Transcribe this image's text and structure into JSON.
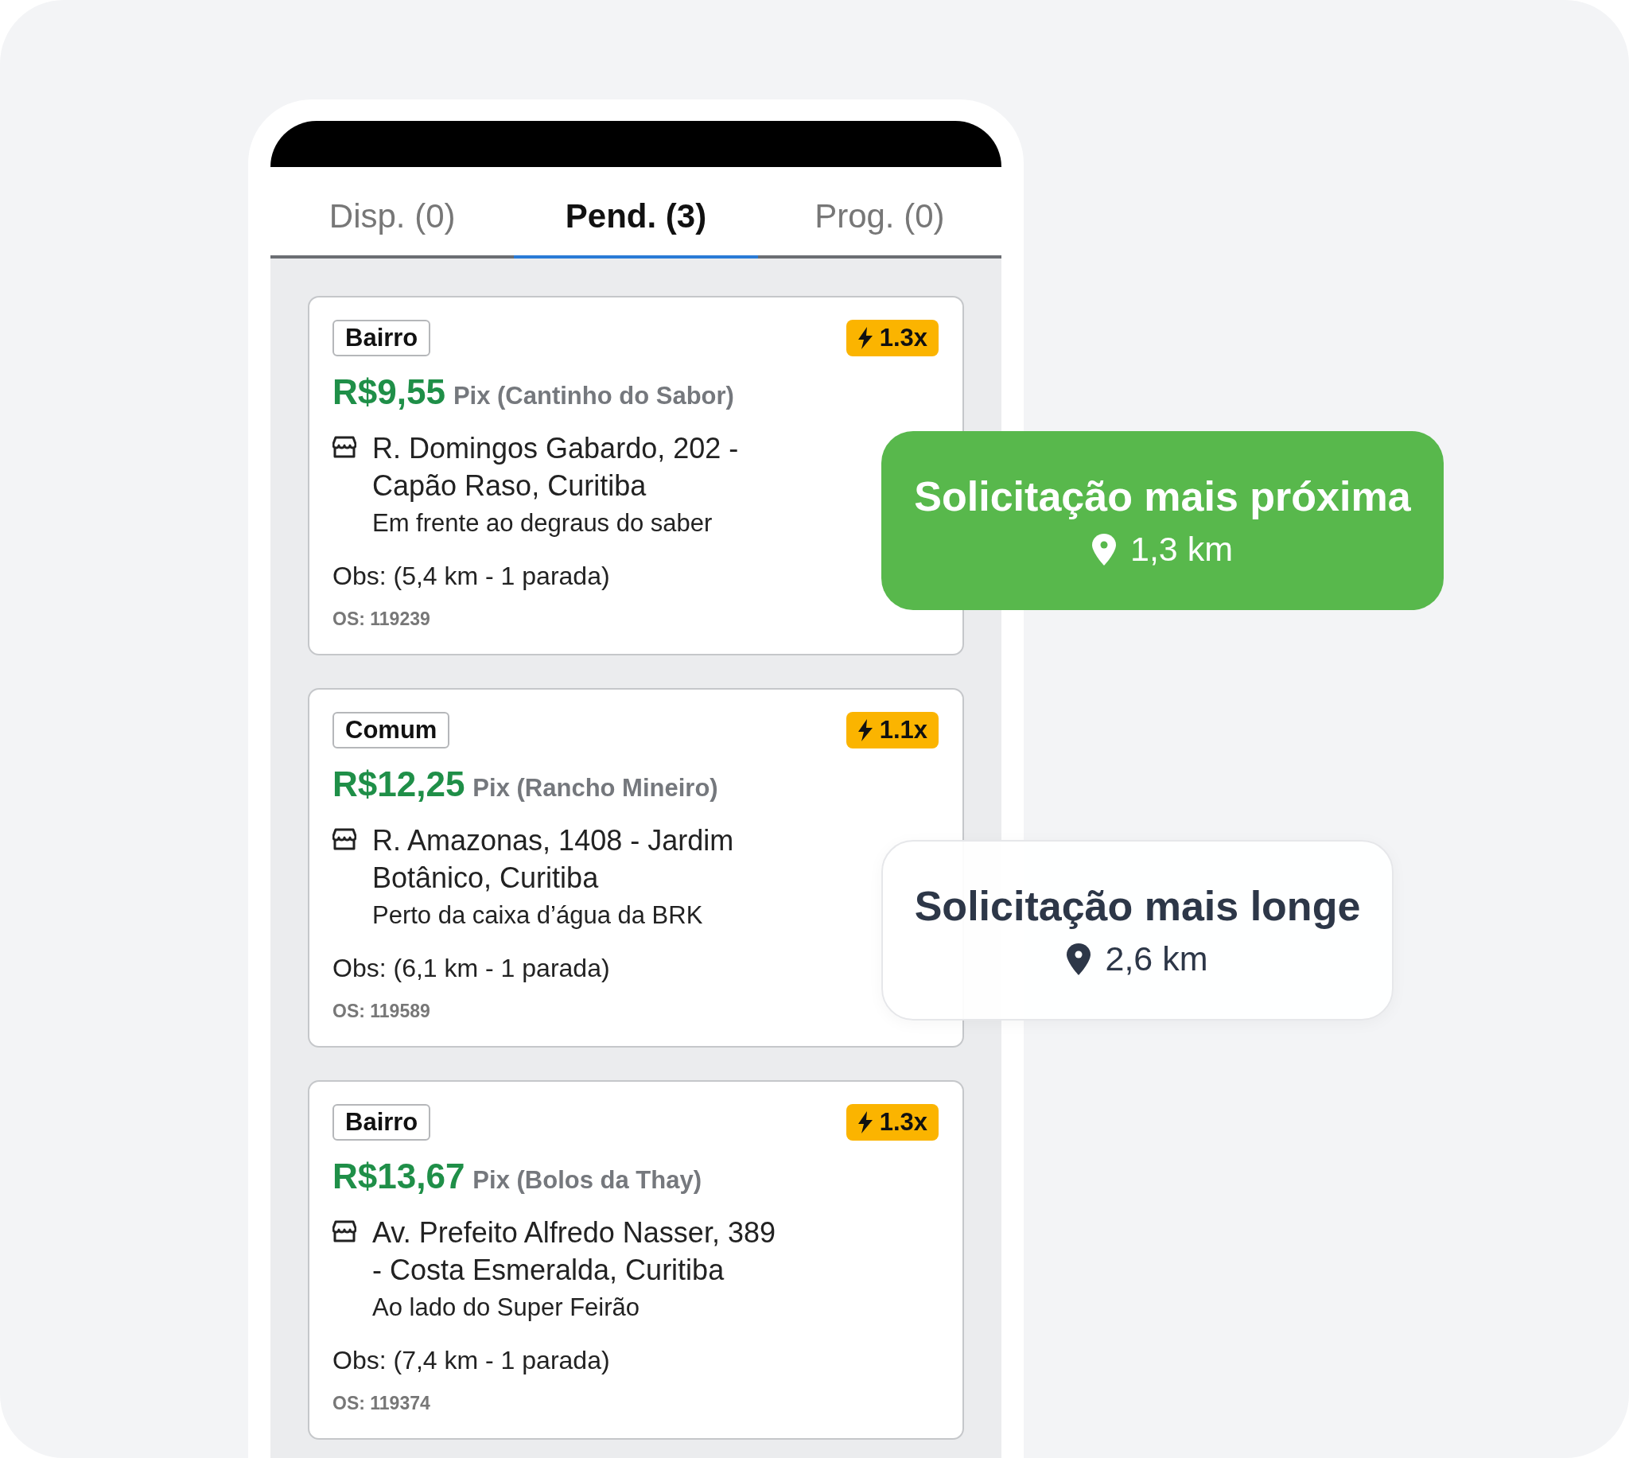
{
  "tabs": [
    {
      "label": "Disp. (0)",
      "selected": false
    },
    {
      "label": "Pend. (3)",
      "selected": true
    },
    {
      "label": "Prog. (0)",
      "selected": false
    }
  ],
  "orders": [
    {
      "tag": "Bairro",
      "multiplier": "1.3x",
      "price": "R$9,55",
      "payment": "Pix (Cantinho do Sabor)",
      "address": "R. Domingos Gabardo, 202 - Capão Raso, Curitiba",
      "reference": "Em frente ao degraus do saber",
      "obs": "Obs: (5,4 km - 1 parada)",
      "os": "OS: 119239"
    },
    {
      "tag": "Comum",
      "multiplier": "1.1x",
      "price": "R$12,25",
      "payment": "Pix (Rancho Mineiro)",
      "address": "R. Amazonas, 1408 - Jardim Botânico, Curitiba",
      "reference": "Perto da caixa d’água da BRK",
      "obs": "Obs: (6,1 km - 1 parada)",
      "os": "OS: 119589"
    },
    {
      "tag": "Bairro",
      "multiplier": "1.3x",
      "price": "R$13,67",
      "payment": "Pix (Bolos da Thay)",
      "address": "Av. Prefeito Alfredo Nasser, 389 - Costa Esmeralda, Curitiba",
      "reference": "Ao lado do Super Feirão",
      "obs": "Obs: (7,4 km - 1 parada)",
      "os": "OS: 119374"
    }
  ],
  "callouts": [
    {
      "kind": "nearest",
      "title": "Solicitação mais próxima",
      "distance": "1,3 km"
    },
    {
      "kind": "farthest",
      "title": "Solicitação mais longe",
      "distance": "2,6 km"
    }
  ]
}
